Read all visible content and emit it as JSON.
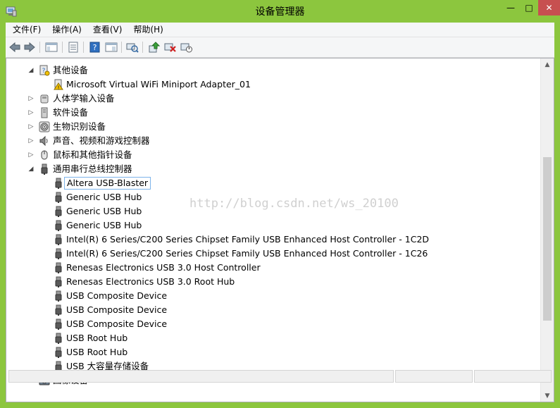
{
  "window": {
    "title": "设备管理器",
    "controls": {
      "minimize": "—",
      "maximize": "□",
      "close": "✕"
    }
  },
  "menu": [
    "文件(F)",
    "操作(A)",
    "查看(V)",
    "帮助(H)"
  ],
  "toolbar": [
    "back-arrow-icon",
    "forward-arrow-icon",
    "console-tree-icon",
    "properties-icon",
    "help-icon",
    "show-view-icon",
    "scan-hardware-icon",
    "update-driver-icon",
    "uninstall-icon",
    "disable-device-icon"
  ],
  "tree": [
    {
      "label": "其他设备",
      "expander": "◢",
      "level": 1,
      "icon": "unknown-device-icon"
    },
    {
      "label": "Microsoft Virtual WiFi Miniport Adapter_01",
      "level": 2,
      "icon": "warning-device-icon"
    },
    {
      "label": "人体学输入设备",
      "expander": "▷",
      "level": 1,
      "icon": "hid-icon"
    },
    {
      "label": "软件设备",
      "expander": "▷",
      "level": 1,
      "icon": "software-device-icon"
    },
    {
      "label": "生物识别设备",
      "expander": "▷",
      "level": 1,
      "icon": "fingerprint-icon"
    },
    {
      "label": "声音、视频和游戏控制器",
      "expander": "▷",
      "level": 1,
      "icon": "speaker-icon"
    },
    {
      "label": "鼠标和其他指针设备",
      "expander": "▷",
      "level": 1,
      "icon": "mouse-icon"
    },
    {
      "label": "通用串行总线控制器",
      "expander": "◢",
      "level": 1,
      "icon": "usb-icon"
    },
    {
      "label": "Altera USB-Blaster",
      "level": 2,
      "icon": "usb-icon",
      "selected": true
    },
    {
      "label": "Generic USB Hub",
      "level": 2,
      "icon": "usb-icon"
    },
    {
      "label": "Generic USB Hub",
      "level": 2,
      "icon": "usb-icon"
    },
    {
      "label": "Generic USB Hub",
      "level": 2,
      "icon": "usb-icon"
    },
    {
      "label": "Intel(R) 6 Series/C200 Series Chipset Family USB Enhanced Host Controller - 1C2D",
      "level": 2,
      "icon": "usb-icon"
    },
    {
      "label": "Intel(R) 6 Series/C200 Series Chipset Family USB Enhanced Host Controller - 1C26",
      "level": 2,
      "icon": "usb-icon"
    },
    {
      "label": "Renesas Electronics USB 3.0 Host Controller",
      "level": 2,
      "icon": "usb-icon"
    },
    {
      "label": "Renesas Electronics USB 3.0 Root Hub",
      "level": 2,
      "icon": "usb-icon"
    },
    {
      "label": "USB Composite Device",
      "level": 2,
      "icon": "usb-icon"
    },
    {
      "label": "USB Composite Device",
      "level": 2,
      "icon": "usb-icon"
    },
    {
      "label": "USB Composite Device",
      "level": 2,
      "icon": "usb-icon"
    },
    {
      "label": "USB Root Hub",
      "level": 2,
      "icon": "usb-icon"
    },
    {
      "label": "USB Root Hub",
      "level": 2,
      "icon": "usb-icon"
    },
    {
      "label": "USB 大容量存储设备",
      "level": 2,
      "icon": "usb-icon"
    },
    {
      "label": "图像设备",
      "expander": "▷",
      "level": 1,
      "icon": "camera-icon"
    }
  ],
  "scrollbar": {
    "up": "▲",
    "down": "▼"
  },
  "watermark": "http://blog.csdn.net/ws_20100",
  "colors": {
    "frame": "#8cc63e",
    "close": "#c75050",
    "selection_border": "#7eb4ea"
  }
}
